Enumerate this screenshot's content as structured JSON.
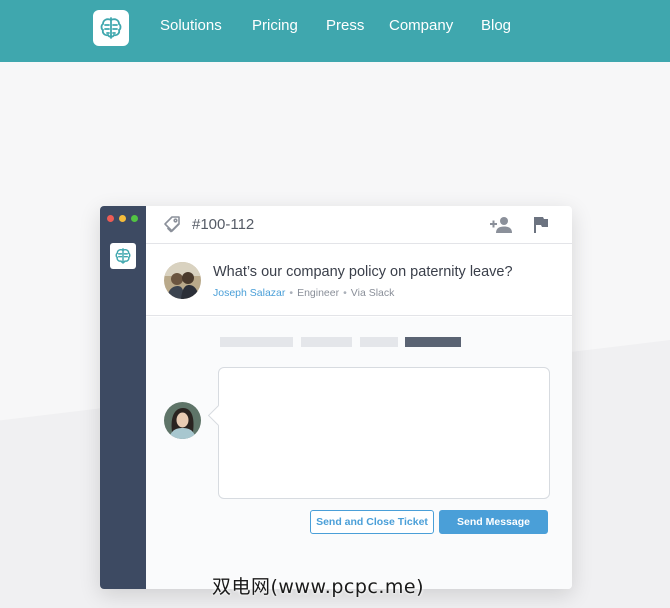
{
  "nav": {
    "items": [
      {
        "label": "Solutions"
      },
      {
        "label": "Pricing"
      },
      {
        "label": "Press"
      },
      {
        "label": "Company"
      },
      {
        "label": "Blog"
      }
    ]
  },
  "ticket": {
    "id": "#100-112",
    "question": "What’s our company policy on paternity leave?",
    "requester": "Joseph Salazar",
    "role": "Engineer",
    "source": "Via Slack"
  },
  "reply": {
    "close_button": "Send and Close Ticket",
    "send_button": "Send Message"
  },
  "watermark": "双电网(www.pcpc.me)",
  "colors": {
    "header_bg": "#3fa7ae",
    "sidebar_bg": "#3d4a62",
    "accent": "#4a9fd8"
  },
  "icons": [
    "brain-logo-icon",
    "tag-icon",
    "add-user-icon",
    "flag-icon"
  ]
}
